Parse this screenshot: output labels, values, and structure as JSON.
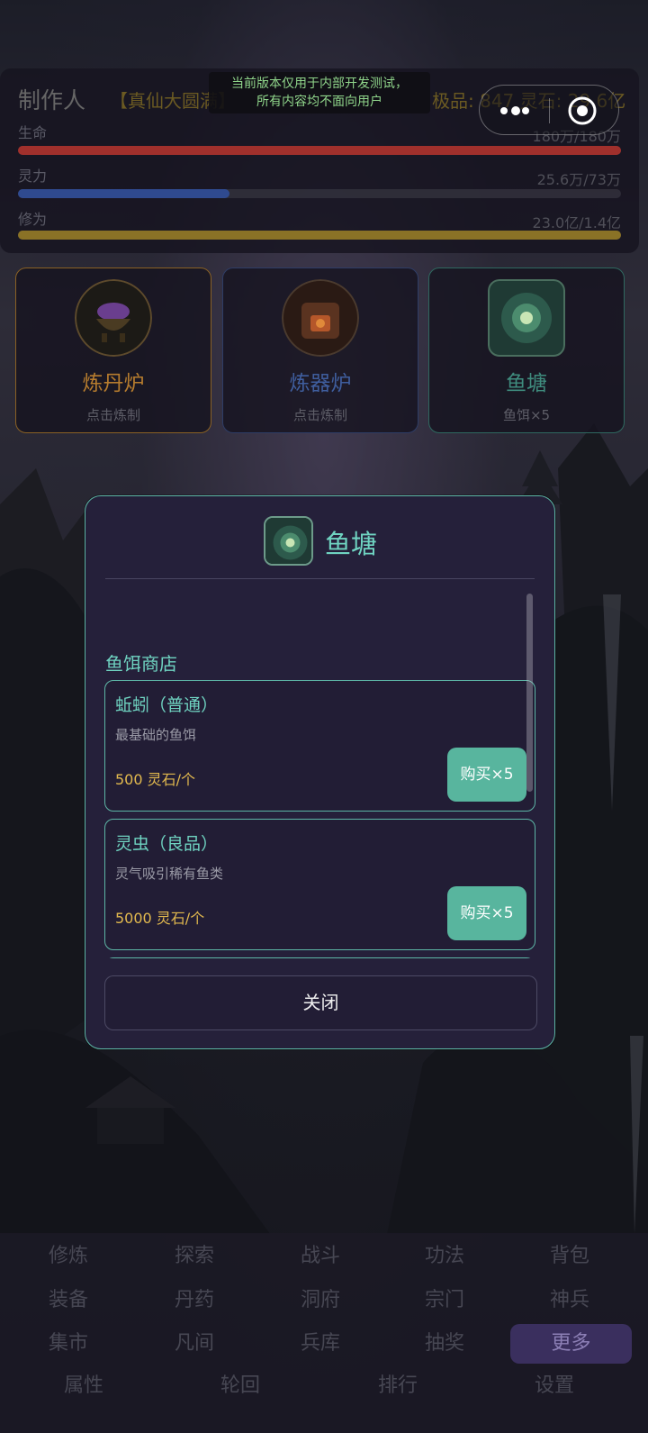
{
  "dev_notice": {
    "line1": "当前版本仅用于内部开发测试，",
    "line2": "所有内容均不面向用户"
  },
  "player": {
    "name": "制作人",
    "realm": "【真仙大圆满】",
    "extra": "极品: 847 灵石: 29.6亿"
  },
  "stats": [
    {
      "label": "生命",
      "value": "180万/180万",
      "color": "#a0302c",
      "fill": 1.0
    },
    {
      "label": "灵力",
      "value": "25.6万/73万",
      "color": "#2f4a8f",
      "fill": 0.35
    },
    {
      "label": "修为",
      "value": "23.0亿/1.4亿",
      "color": "#8a7226",
      "fill": 1.0
    }
  ],
  "cards": [
    {
      "name": "炼丹炉",
      "sub": "点击炼制",
      "color": "#b67c2e",
      "border": "#8a6124"
    },
    {
      "name": "炼器炉",
      "sub": "点击炼制",
      "color": "#3f5e9e",
      "border": "#2e3d66"
    },
    {
      "name": "鱼塘",
      "sub": "鱼饵×5",
      "color": "#3f8c7e",
      "border": "#2f6960"
    }
  ],
  "modal": {
    "title": "鱼塘",
    "section": "鱼饵商店",
    "items": [
      {
        "name": "蚯蚓（普通）",
        "desc": "最基础的鱼饵",
        "price": "500 灵石/个",
        "button": "购买×5"
      },
      {
        "name": "灵虫（良品）",
        "desc": "灵气吸引稀有鱼类",
        "price": "5000 灵石/个",
        "button": "购买×5"
      }
    ],
    "close_label": "关闭"
  },
  "nav": {
    "row1": [
      "修炼",
      "探索",
      "战斗",
      "功法",
      "背包"
    ],
    "row2": [
      "装备",
      "丹药",
      "洞府",
      "宗门",
      "神兵"
    ],
    "row3": [
      "集市",
      "凡间",
      "兵库",
      "抽奖",
      "更多"
    ],
    "row4": [
      "属性",
      "轮回",
      "排行",
      "设置"
    ],
    "active": "更多"
  }
}
